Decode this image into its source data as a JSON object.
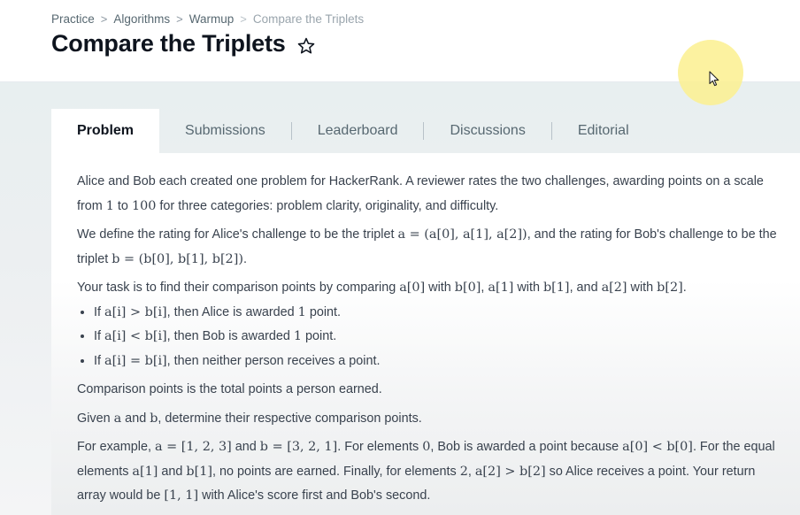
{
  "breadcrumb": {
    "items": [
      "Practice",
      "Algorithms",
      "Warmup",
      "Compare the Triplets"
    ],
    "separator": ">"
  },
  "title": "Compare the Triplets",
  "icons": {
    "favorite": "star-outline-icon",
    "cursor": "mouse-pointer-icon"
  },
  "tabs": [
    "Problem",
    "Submissions",
    "Leaderboard",
    "Discussions",
    "Editorial"
  ],
  "active_tab": "Problem",
  "problem": {
    "p1": {
      "t1": "Alice and Bob each created one problem for HackerRank. A reviewer rates the two challenges, awarding points on a scale from ",
      "m1": "1",
      "t2": " to ",
      "m2": "100",
      "t3": " for three categories: problem clarity, originality, and difficulty."
    },
    "p2": {
      "t1": "We define the rating for Alice's challenge to be the triplet ",
      "m1": "a = (a[0], a[1], a[2])",
      "t2": ", and the rating for Bob's challenge to be the triplet ",
      "m2": "b = (b[0], b[1], b[2])",
      "t3": "."
    },
    "p3": {
      "t1": "Your task is to find their comparison points by comparing ",
      "m1": "a[0]",
      "t2": " with ",
      "m2": "b[0]",
      "t3": ", ",
      "m3": "a[1]",
      "t4": " with ",
      "m4": "b[1]",
      "t5": ", and ",
      "m5": "a[2]",
      "t6": " with ",
      "m6": "b[2]",
      "t7": "."
    },
    "bullets": [
      {
        "t1": "If ",
        "m1": "a[i] > b[i]",
        "t2": ", then Alice is awarded ",
        "m2": "1",
        "t3": " point."
      },
      {
        "t1": "If ",
        "m1": "a[i] < b[i]",
        "t2": ", then Bob is awarded ",
        "m2": "1",
        "t3": " point."
      },
      {
        "t1": "If ",
        "m1": "a[i] = b[i]",
        "t2": ", then neither person receives a point."
      }
    ],
    "p4": "Comparison points is the total points a person earned.",
    "p5": {
      "t1": "Given ",
      "m1": "a",
      "t2": " and ",
      "m2": "b",
      "t3": ", determine their respective comparison points."
    },
    "p6": {
      "t1": "For example, ",
      "m1": "a = [1, 2, 3]",
      "t2": " and ",
      "m2": "b = [3, 2, 1]",
      "t3": ". For elements ",
      "m3": "0",
      "t4": ", Bob is awarded a point because ",
      "m4": "a[0] < b[0]",
      "t5": ". For the equal elements ",
      "m5": "a[1]",
      "t6": " and ",
      "m6": "b[1]",
      "t7": ", no points are earned. Finally, for elements ",
      "m7": "2",
      "t8": ", ",
      "m8": "a[2] > b[2]",
      "t9": " so Alice receives a point. Your return array would be ",
      "m9": "[1, 1]",
      "t10": " with Alice's score first and Bob's second."
    }
  }
}
